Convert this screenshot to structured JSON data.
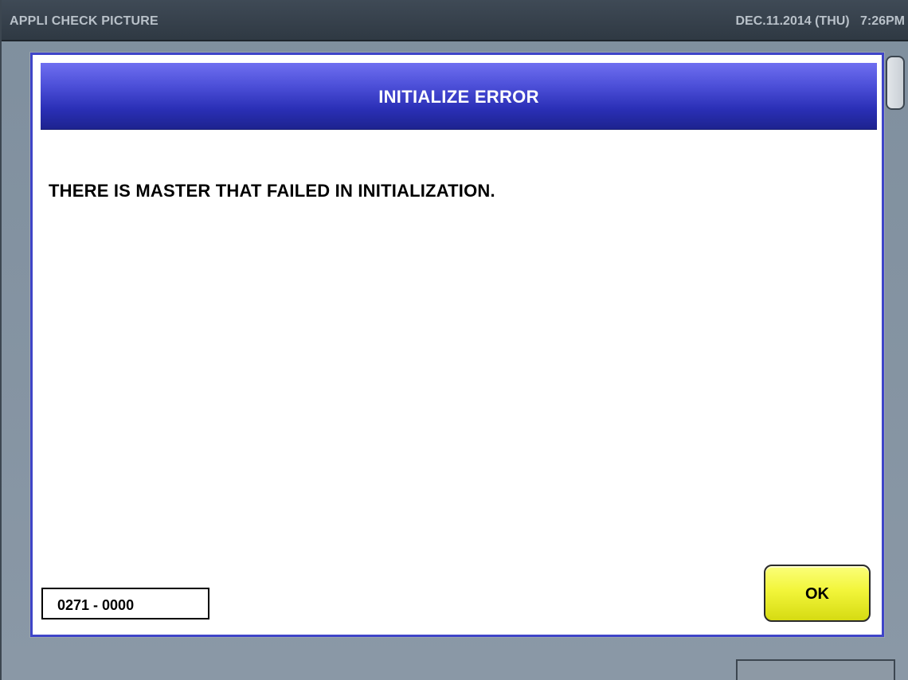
{
  "title_bar": {
    "app_title": "APPLI CHECK PICTURE",
    "datetime": "DEC.11.2014 (THU)   7:26PM"
  },
  "dialog": {
    "title": "INITIALIZE ERROR",
    "message": "THERE IS MASTER THAT FAILED IN INITIALIZATION.",
    "error_code": "0271 - 0000",
    "ok_label": "OK"
  },
  "colors": {
    "dialog_border": "#3f45c8",
    "dialog_header_top": "#6f6ff0",
    "dialog_header_bottom": "#1d238f",
    "ok_button": "#f2f53a",
    "background": "#8a98a6"
  }
}
